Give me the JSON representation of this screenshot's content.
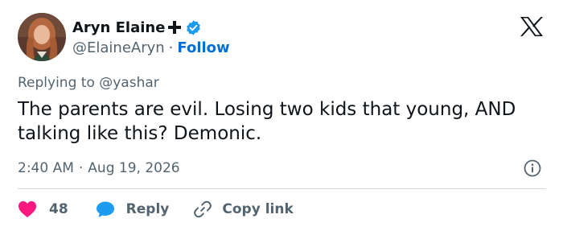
{
  "author": {
    "display_name": "Aryn Elaine",
    "handle": "@ElaineAryn",
    "separator": "·",
    "follow_label": "Follow"
  },
  "reply_context": {
    "prefix": "Replying to",
    "mention": "@yashar"
  },
  "tweet": {
    "text": "The parents are evil. Losing two kids that young, AND talking like this? Demonic.",
    "time": "2:40 AM",
    "separator": "·",
    "date": "Aug 19, 2026"
  },
  "actions": {
    "like_count": "48",
    "reply_label": "Reply",
    "copy_link_label": "Copy link"
  },
  "icons": {
    "cross": "cross-icon",
    "verified": "verified-badge-icon",
    "logo": "x-logo-icon",
    "info": "info-icon",
    "like": "heart-icon",
    "reply": "speech-bubble-icon",
    "copy": "link-icon"
  },
  "colors": {
    "text_primary": "#0f1419",
    "text_secondary": "#536471",
    "follow_link": "#006fd6",
    "verified_badge": "#1d9bf0",
    "like_heart": "#f91880",
    "reply_bubble": "#1d9bf0",
    "divider": "#cfd9de"
  }
}
